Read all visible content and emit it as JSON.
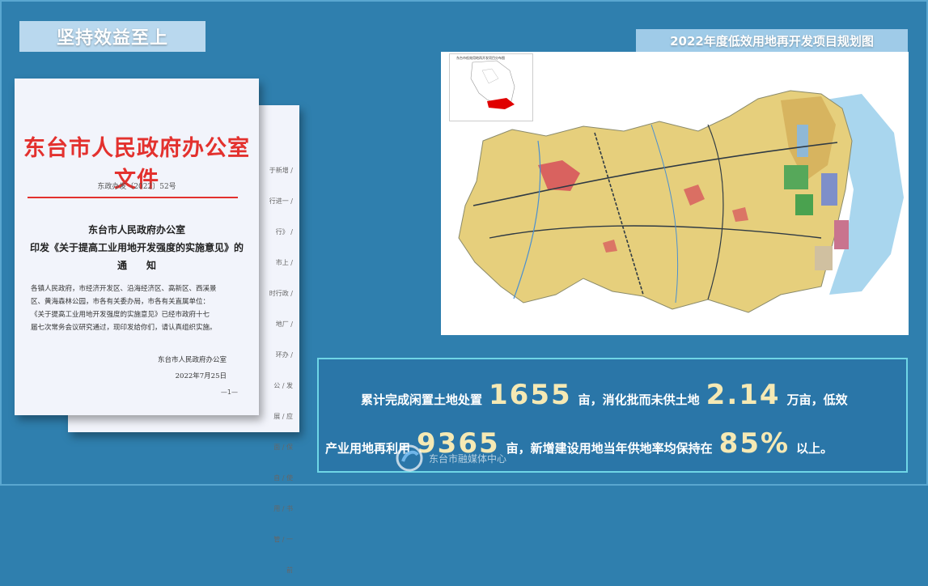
{
  "header": {
    "title": "坚持效益至上"
  },
  "map": {
    "title": "2022年度低效用地再开发项目规划图",
    "inset_title": "东台市低效用地再开发项目分布图"
  },
  "document": {
    "header": "东台市人民政府办公室文件",
    "number": "东政办发〔2022〕52号",
    "subject_lines": [
      "东台市人民政府办公室",
      "印发《关于提高工业用地开发强度的实施意见》的",
      "通　　知"
    ],
    "body_lines": [
      "各镇人民政府，市经济开发区、沿海经济区、高新区、西溪景",
      "区、黄海森林公园，市各有关委办局，市各有关直属单位：",
      "《关于提高工业用地开发强度的实施意见》已经市政府十七",
      "届七次常务会议研究通过，现印发给你们，请认真组织实施。"
    ],
    "signature_org": "东台市人民政府办公室",
    "signature_date": "2022年7月25日",
    "page_mark": "—1—",
    "back_side_text": "于新增 / 行进一 / 行》 / 市上 / 时行政 / 地厂 / 环办 / 公 / 发展 / 应面 / 保自 / 使用 / 书管 / 一前"
  },
  "stats": {
    "line1_prefix": "累计完成闲置土地处置",
    "value1": "1655",
    "line1_mid": "亩，消化批而未供土地",
    "value2": "2.14",
    "line1_suffix": "万亩，低效",
    "line2_prefix": "产业用地再利用",
    "value3": "9365",
    "line2_mid": "亩，新增建设用地当年供地率均保持在",
    "value4": "85%",
    "line2_suffix": "以上。"
  },
  "watermark": {
    "text": "东台市融媒体中心"
  },
  "colors": {
    "background": "#2f7fae",
    "accent_number": "#f5e9b4",
    "doc_red": "#e3312e",
    "stats_border": "#6fd6e6"
  }
}
